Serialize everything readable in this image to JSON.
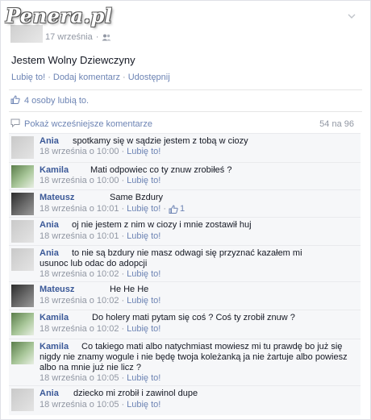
{
  "watermark": "Penera.pl",
  "post": {
    "date": "17 września",
    "dot": "·",
    "text": "Jestem Wolny Dziewczyny",
    "actions": [
      "Lubię to!",
      "Dodaj komentarz",
      "Udostępnij"
    ],
    "likes_text": "4 osoby lubią to.",
    "previous_comments_label": "Pokaż wcześniejsze komentarze",
    "comments_count": "54 na 96"
  },
  "comments": [
    {
      "name": "Ania",
      "text": "spotkamy się w sądzie jestem z tobą w ciozy",
      "time": "18 września o 10:00",
      "like": "Lubię to!",
      "avatar": "grey"
    },
    {
      "name": "Kamila",
      "text": "Mati odpowiec co ty znuw zrobiłeś ?",
      "time": "18 września o 10:00",
      "like": "Lubię to!",
      "avatar": "green"
    },
    {
      "name": "Mateusz",
      "text": "Same Bzdury",
      "time": "18 września o 10:01",
      "like": "Lubię to!",
      "avatar": "dark",
      "likes": "1"
    },
    {
      "name": "Ania",
      "text": "oj nie jestem z nim w ciozy i mnie zostawił huj",
      "time": "18 września o 10:01",
      "like": "Lubię to!",
      "avatar": "grey"
    },
    {
      "name": "Ania",
      "text_line1": "to nie są bzdury nie masz odwagi się przyznać kazałem mi",
      "text_line2": "usunoc lub odac do adopcji",
      "time": "18 września o 10:02",
      "like": "Lubię to!",
      "avatar": "grey"
    },
    {
      "name": "Mateusz",
      "text": "He He He",
      "time": "18 września o 10:02",
      "like": "Lubię to!",
      "avatar": "dark"
    },
    {
      "name": "Kamila",
      "text": "Do holery mati pytam się coś ? Coś ty zrobił znuw ?",
      "time": "18 września o 10:02",
      "like": "Lubię to!",
      "avatar": "green"
    },
    {
      "name": "Kamila",
      "text_line1": "Co takiego mati albo natychmiast mowiesz mi tu prawdę bo już się",
      "text_line2": "nigdy nie znamy wogule i nie będę twoja koleżanką ja nie żartuje albo powiesz",
      "text_line3": "albo na mnie już nie licz ?",
      "time": "18 września o 10:05",
      "like": "Lubię to!",
      "avatar": "green"
    },
    {
      "name": "Ania",
      "text": "dziecko mi zrobił i zawinol dupe",
      "time": "18 września o 10:05",
      "like": "Lubię to!",
      "avatar": "grey"
    }
  ],
  "icons": {
    "chevron": "chevron-down-icon",
    "audience": "friends-icon",
    "thumb": "thumbs-up-icon",
    "comment": "comment-icon"
  },
  "colors": {
    "link": "#6d84b4",
    "name": "#3b5998",
    "muted": "#9197a3",
    "comment_bg": "#f6f7f9"
  }
}
